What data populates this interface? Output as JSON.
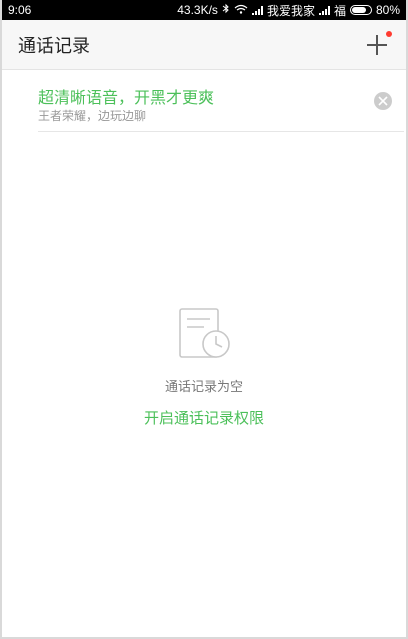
{
  "status_bar": {
    "time": "9:06",
    "net_speed": "43.3K/s",
    "carrier1": "我爱我家",
    "carrier2": "福",
    "battery": "80%",
    "battery_level": 0.8
  },
  "header": {
    "title": "通话记录",
    "add_icon": "plus-icon",
    "has_notification_dot": true
  },
  "promo": {
    "title": "超清晰语音，开黑才更爽",
    "subtitle": "王者荣耀，边玩边聊",
    "close_icon": "close-icon"
  },
  "empty_state": {
    "icon": "call-log-clock-icon",
    "message": "通话记录为空",
    "action": "开启通话记录权限"
  },
  "colors": {
    "accent": "#4cc05a",
    "badge": "#ff3b30"
  }
}
